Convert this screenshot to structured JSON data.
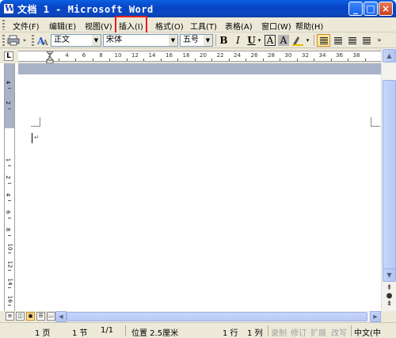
{
  "window": {
    "title": "文档 1 - Microsoft Word",
    "app_icon": "W",
    "minimize": "_",
    "maximize": "□",
    "close": "×"
  },
  "menu": {
    "items": [
      {
        "label": "文件(F)"
      },
      {
        "label": "编辑(E)"
      },
      {
        "label": "视图(V)"
      },
      {
        "label": "插入(I)",
        "highlighted": true
      },
      {
        "label": "格式(O)"
      },
      {
        "label": "工具(T)"
      },
      {
        "label": "表格(A)"
      },
      {
        "label": "窗口(W)"
      },
      {
        "label": "帮助(H)"
      }
    ]
  },
  "toolbar": {
    "style_value": "正文",
    "font_value": "宋体",
    "size_value": "五号",
    "bold": "B",
    "italic": "I",
    "underline": "U",
    "char_border": "A",
    "char_shading": "A",
    "highlight_color": "#e8c000"
  },
  "ruler": {
    "corner": "L",
    "labels": [
      "2",
      "4",
      "6",
      "8",
      "10",
      "12",
      "14",
      "16",
      "18",
      "20",
      "22",
      "24",
      "26",
      "28",
      "30",
      "32",
      "34",
      "36",
      "38"
    ],
    "vertical_labels": [
      "4",
      "2",
      "1",
      "2",
      "4",
      "6",
      "8",
      "10",
      "12",
      "14",
      "16"
    ]
  },
  "status": {
    "page": "1 页",
    "section": "1 节",
    "page_of": "1/1",
    "position": "位置 2.5厘米",
    "line": "1 行",
    "column": "1 列",
    "record": "录制",
    "revise": "修订",
    "extend": "扩展",
    "overwrite": "改写",
    "language": "中文(中"
  }
}
